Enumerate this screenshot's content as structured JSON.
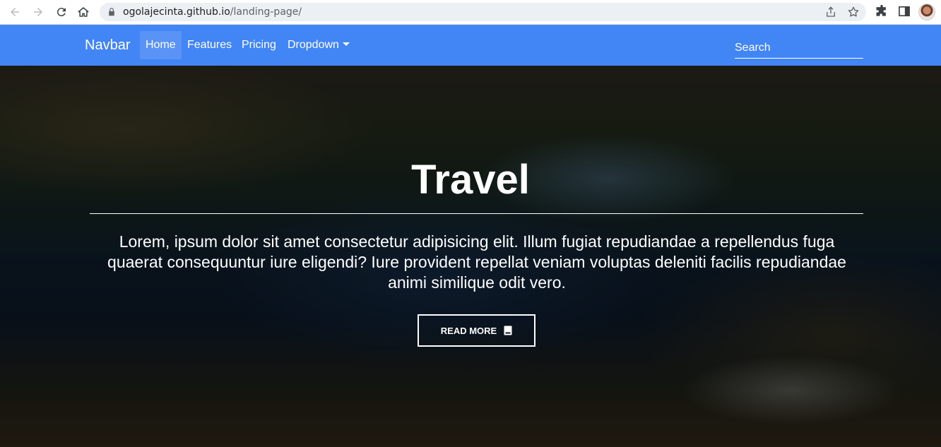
{
  "browser": {
    "url_host": "ogolajecinta.github.io",
    "url_path": "/landing-page/"
  },
  "navbar": {
    "brand": "Navbar",
    "items": [
      {
        "label": "Home",
        "active": true
      },
      {
        "label": "Features",
        "active": false
      },
      {
        "label": "Pricing",
        "active": false
      },
      {
        "label": "Dropdown",
        "active": false,
        "has_caret": true
      }
    ],
    "search_placeholder": "Search",
    "background": "#4285f4"
  },
  "hero": {
    "title": "Travel",
    "text": "Lorem, ipsum dolor sit amet consectetur adipisicing elit. Illum fugiat repudiandae a repellendus fuga quaerat consequuntur iure eligendi? Iure provident repellat veniam voluptas deleniti facilis repudiandae animi similique odit vero.",
    "button_label": "READ MORE",
    "button_icon": "book-icon"
  }
}
